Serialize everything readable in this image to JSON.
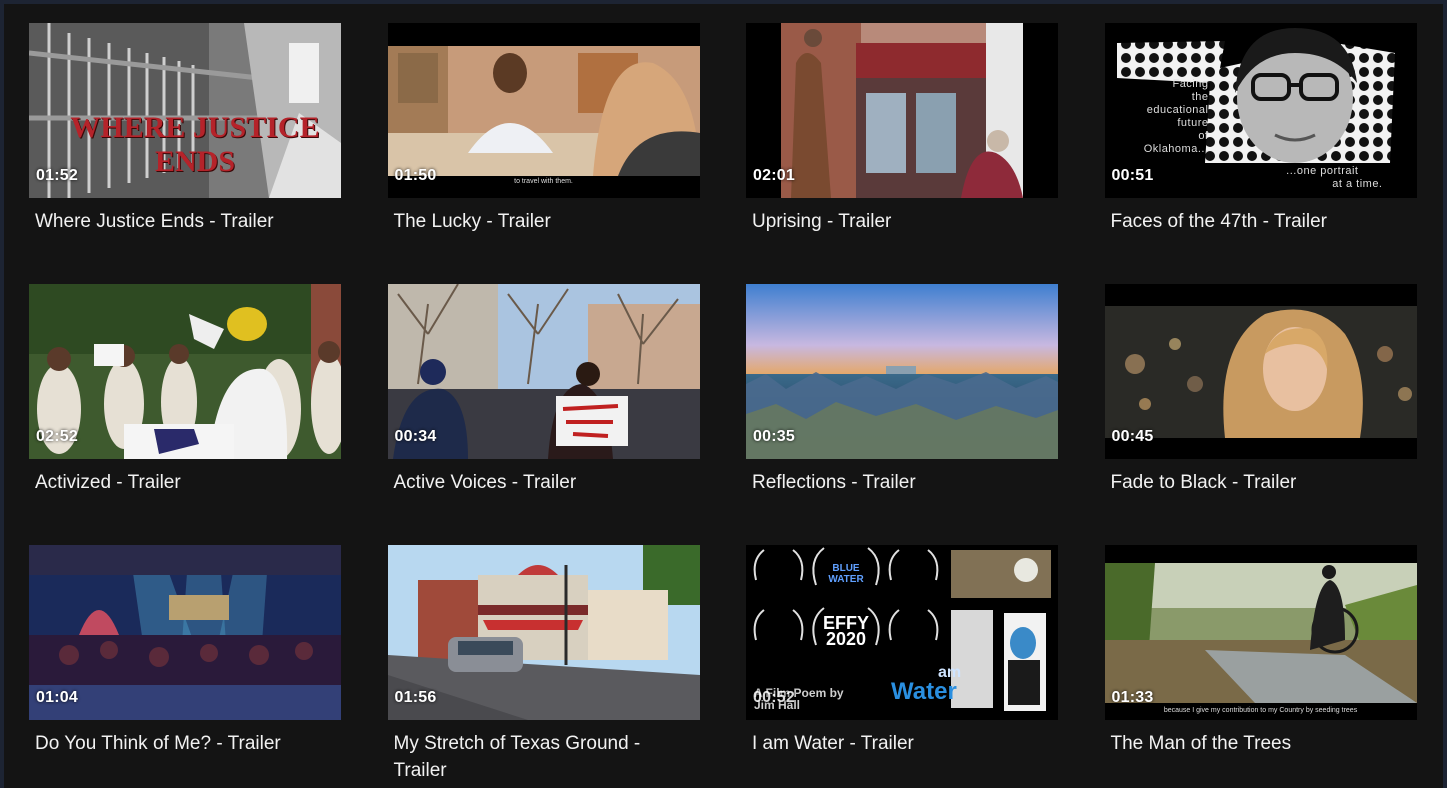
{
  "videos": [
    {
      "title": "Where Justice Ends - Trailer",
      "duration": "01:52",
      "overlay": [
        "WHERE JUSTICE",
        "ENDS"
      ]
    },
    {
      "title": "The Lucky - Trailer",
      "duration": "01:50",
      "subtitle": "to travel with them."
    },
    {
      "title": "Uprising - Trailer",
      "duration": "02:01"
    },
    {
      "title": "Faces of the 47th - Trailer",
      "duration": "00:51",
      "overlay": [
        "Facing",
        "the",
        "educational",
        "future",
        "of",
        "Oklahoma...",
        "...one portrait",
        "at a time."
      ]
    },
    {
      "title": "Activized - Trailer",
      "duration": "02:52"
    },
    {
      "title": "Active Voices - Trailer",
      "duration": "00:34"
    },
    {
      "title": "Reflections - Trailer",
      "duration": "00:35"
    },
    {
      "title": "Fade to Black - Trailer",
      "duration": "00:45"
    },
    {
      "title": "Do You Think of Me? - Trailer",
      "duration": "01:04"
    },
    {
      "title": "My Stretch of Texas Ground - Trailer",
      "duration": "01:56"
    },
    {
      "title": "I am Water - Trailer",
      "duration": "00:52",
      "overlay": [
        "A Film Poem by",
        "Jim Hall",
        "am",
        "Water",
        "EFFY",
        "2020",
        "BLUE WATER"
      ]
    },
    {
      "title": "The Man of the Trees",
      "duration": "01:33",
      "subtitle": "because I give my contribution to my Country by seeding trees"
    }
  ],
  "icons": {
    "thumbnail": "video-thumbnail-icon"
  },
  "colors": {
    "background": "#141414",
    "frame": "#1d2433",
    "title_text": "#f2f2f2",
    "accent_red": "#b5232a"
  }
}
